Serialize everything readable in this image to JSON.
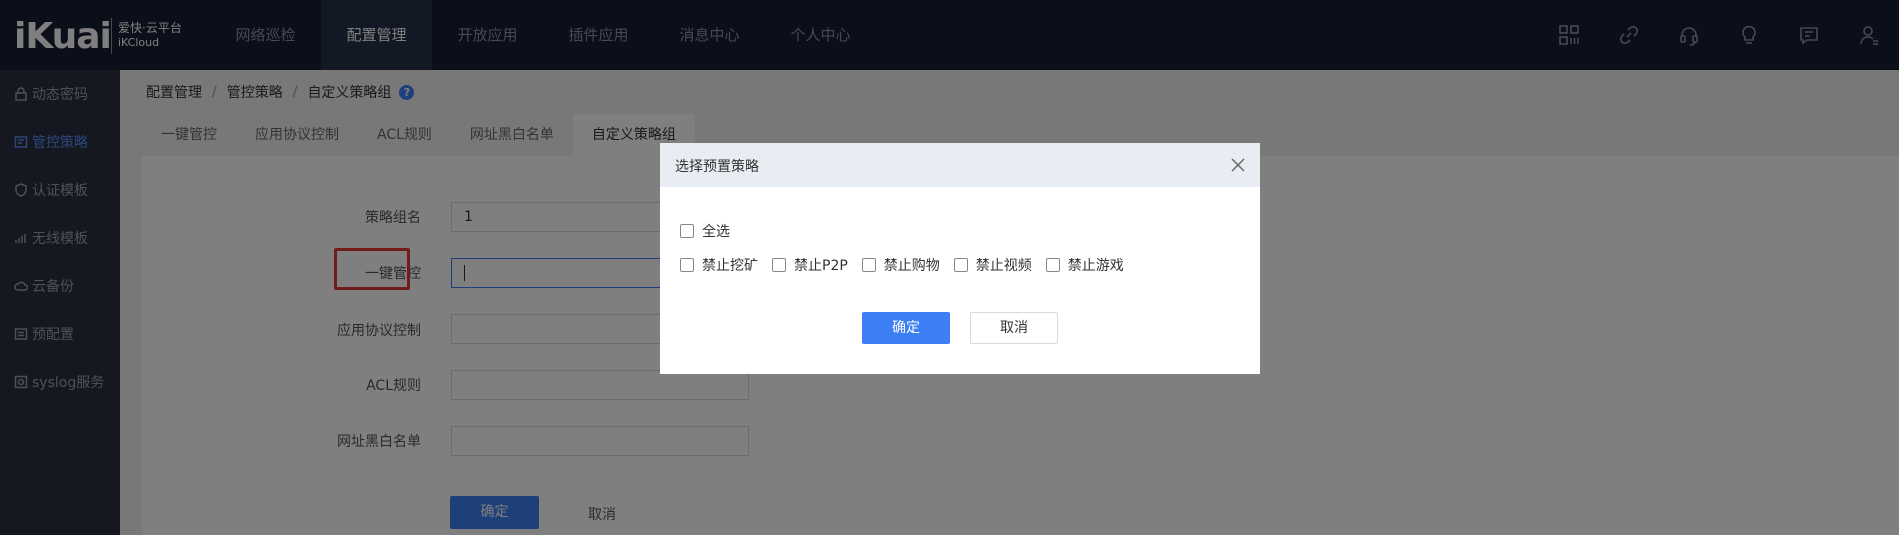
{
  "brand": {
    "logo": "iKuai",
    "sub1": "爱快·云平台",
    "sub2": "iKCloud"
  },
  "topnav": [
    {
      "label": "网络巡检"
    },
    {
      "label": "配置管理"
    },
    {
      "label": "开放应用"
    },
    {
      "label": "插件应用"
    },
    {
      "label": "消息中心"
    },
    {
      "label": "个人中心"
    }
  ],
  "top_icons": [
    "grid-icon",
    "link-icon",
    "headset-icon",
    "bulb-icon",
    "message-icon",
    "user-icon"
  ],
  "sidebar": {
    "items": [
      {
        "label": "动态密码",
        "icon": "lock-icon"
      },
      {
        "label": "管控策略",
        "icon": "policy-icon"
      },
      {
        "label": "认证模板",
        "icon": "shield-icon"
      },
      {
        "label": "无线模板",
        "icon": "wifi-icon"
      },
      {
        "label": "云备份",
        "icon": "cloud-icon"
      },
      {
        "label": "预配置",
        "icon": "list-icon"
      },
      {
        "label": "syslog服务",
        "icon": "server-icon"
      }
    ]
  },
  "breadcrumb": {
    "items": [
      "配置管理",
      "管控策略",
      "自定义策略组"
    ],
    "help": "?"
  },
  "tabs": [
    {
      "label": "一键管控"
    },
    {
      "label": "应用协议控制"
    },
    {
      "label": "ACL规则"
    },
    {
      "label": "网址黑白名单"
    },
    {
      "label": "自定义策略组"
    }
  ],
  "form": {
    "fields": [
      {
        "label": "策略组名",
        "value": "1"
      },
      {
        "label": "一键管控",
        "value": ""
      },
      {
        "label": "应用协议控制",
        "value": ""
      },
      {
        "label": "ACL规则",
        "value": ""
      },
      {
        "label": "网址黑白名单",
        "value": ""
      }
    ],
    "ok_label": "确定",
    "cancel_label": "取消"
  },
  "modal": {
    "title": "选择预置策略",
    "select_all": "全选",
    "options": [
      "禁止挖矿",
      "禁止P2P",
      "禁止购物",
      "禁止视频",
      "禁止游戏"
    ],
    "ok_label": "确定",
    "cancel_label": "取消"
  },
  "colors": {
    "topbar": "#161f33",
    "sidebar": "#2a3143",
    "accent": "#3d7ef5",
    "highlight": "#e53935"
  }
}
